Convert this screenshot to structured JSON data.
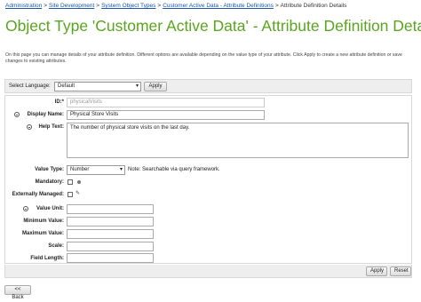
{
  "breadcrumb": {
    "items": [
      "Administration",
      "Site Development",
      "System Object Types",
      "Customer Active Data - Attribute Definitions"
    ],
    "current": "Attribute Definition Details"
  },
  "page": {
    "title": "Object Type 'Customer Active Data' - Attribute Definition Details",
    "intro": "On this page you can manage details of your attribute definition. Different options are available depending on the value type of your attribute. Click Apply to create a new attribute definition or save changes to existing attributes."
  },
  "language": {
    "label": "Select Language:",
    "selected": "Default",
    "apply_label": "Apply"
  },
  "form": {
    "id_label": "ID:*",
    "id_value": "physicalVisits",
    "display_name_label": "Display Name:",
    "display_name_value": "Physical Store Visits",
    "help_text_label": "Help Text:",
    "help_text_value": "The number of physical store visits on the last day.",
    "value_type_label": "Value Type:",
    "value_type_selected": "Number",
    "value_type_note": "Note: Searchable via query framework.",
    "mandatory_label": "Mandatory:",
    "externally_managed_label": "Externally Managed:",
    "value_unit_label": "Value Unit:",
    "minimum_value_label": "Minimum Value:",
    "maximum_value_label": "Maximum Value:",
    "scale_label": "Scale:",
    "field_length_label": "Field Length:"
  },
  "footer": {
    "apply_label": "Apply",
    "reset_label": "Reset",
    "back_label": "<< Back"
  }
}
